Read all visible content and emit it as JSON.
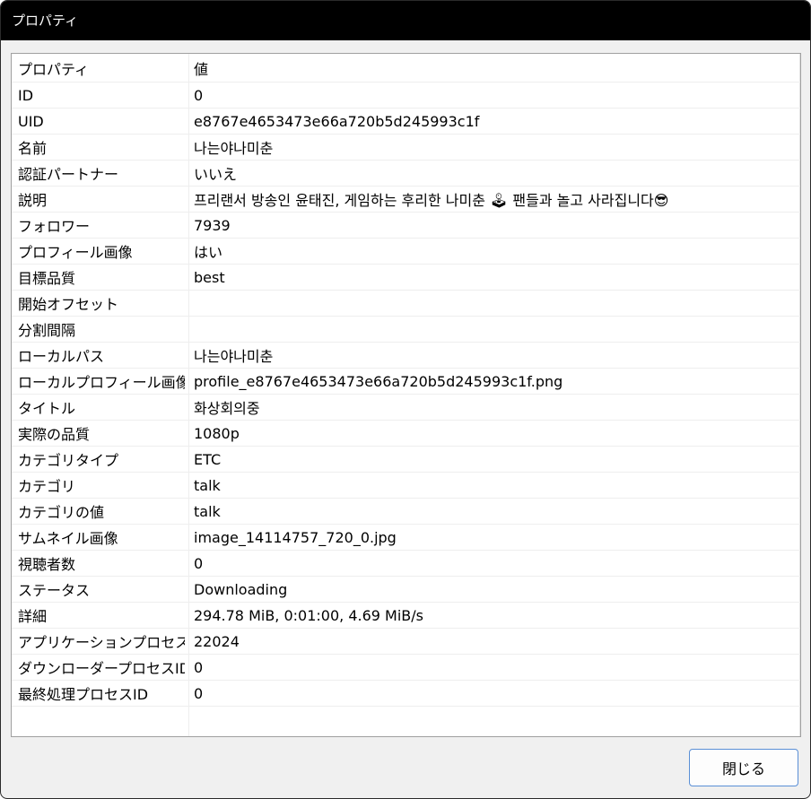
{
  "window": {
    "title": "プロパティ"
  },
  "table": {
    "columns": {
      "name": "プロパティ",
      "value": "値"
    },
    "rows": [
      {
        "name": "ID",
        "value": "0"
      },
      {
        "name": "UID",
        "value": "e8767e4653473e66a720b5d245993c1f"
      },
      {
        "name": "名前",
        "value": "나는야나미춘"
      },
      {
        "name": "認証パートナー",
        "value": "いいえ"
      },
      {
        "name": "説明",
        "value": "프리랜서 방송인 윤태진, 게임하는 후리한 나미춘 🕹 팬들과 놀고 사라집니다😎"
      },
      {
        "name": "フォロワー",
        "value": "7939"
      },
      {
        "name": "プロフィール画像",
        "value": "はい"
      },
      {
        "name": "目標品質",
        "value": "best"
      },
      {
        "name": "開始オフセット",
        "value": ""
      },
      {
        "name": "分割間隔",
        "value": ""
      },
      {
        "name": "ローカルパス",
        "value": "나는야나미춘"
      },
      {
        "name": "ローカルプロフィール画像",
        "value": "profile_e8767e4653473e66a720b5d245993c1f.png"
      },
      {
        "name": "タイトル",
        "value": "화상회의중"
      },
      {
        "name": "実際の品質",
        "value": "1080p"
      },
      {
        "name": "カテゴリタイプ",
        "value": "ETC"
      },
      {
        "name": "カテゴリ",
        "value": "talk"
      },
      {
        "name": "カテゴリの値",
        "value": "talk"
      },
      {
        "name": "サムネイル画像",
        "value": "image_14114757_720_0.jpg"
      },
      {
        "name": "視聴者数",
        "value": "0"
      },
      {
        "name": "ステータス",
        "value": "Downloading"
      },
      {
        "name": "詳細",
        "value": "294.78 MiB, 0:01:00, 4.69 MiB/s"
      },
      {
        "name": "アプリケーションプロセスID",
        "value": "22024"
      },
      {
        "name": "ダウンローダープロセスID",
        "value": "0"
      },
      {
        "name": "最終処理プロセスID",
        "value": "0"
      }
    ]
  },
  "footer": {
    "close_label": "閉じる"
  }
}
